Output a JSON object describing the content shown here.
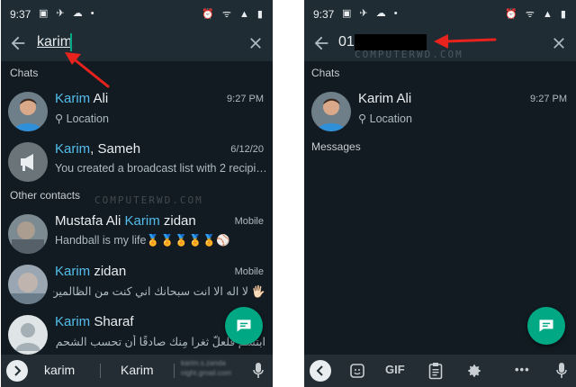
{
  "left": {
    "status": {
      "time": "9:37"
    },
    "search": {
      "query": "karim"
    },
    "sections": {
      "chats": "Chats",
      "other_contacts": "Other contacts"
    },
    "chats": [
      {
        "highlight": "Karim",
        "rest": " Ali",
        "subtitle": "Location",
        "time": "9:27 PM"
      },
      {
        "highlight": "Karim",
        "rest": ", Sameh",
        "subtitle": "You created a broadcast list with 2 recipi…",
        "time": "6/12/20"
      }
    ],
    "contacts": [
      {
        "before": "Mustafa Ali ",
        "highlight": "Karim",
        "rest": " zidan",
        "type": "Mobile",
        "status": "Handball is my life🏅🏅🏅🏅🏅⚾"
      },
      {
        "before": "",
        "highlight": "Karim",
        "rest": " zidan",
        "type": "Mobile",
        "status": "🖐🏻 لا اله الا انت سبحانك اني كنت من الظالمين🖐🏻 ا..."
      },
      {
        "before": "",
        "highlight": "Karim",
        "rest": " Sharaf",
        "type": "",
        "status": "ابتسم فلعلّ ثغرٍا مِنك صادقًا أن تحسب الشحم فيمن ..."
      }
    ],
    "keyboard": {
      "suggest_1": "karim",
      "suggest_2": "Karim",
      "suggest_3": "karim.s.zanda\nnight.gmail.com"
    }
  },
  "right": {
    "status": {
      "time": "9:37"
    },
    "search": {
      "query": "01"
    },
    "sections": {
      "chats": "Chats",
      "messages": "Messages"
    },
    "chat": {
      "name": "Karim Ali",
      "subtitle": "Location",
      "time": "9:27 PM"
    },
    "keyboard": {
      "gif": "GIF",
      "more": "•••"
    }
  },
  "watermark": "COMPUTERWD.COM",
  "colors": {
    "accent": "#00a884",
    "highlight": "#53bdeb",
    "annotation": "#e8221c",
    "bg": "#121b22",
    "bar": "#1f2c34"
  }
}
